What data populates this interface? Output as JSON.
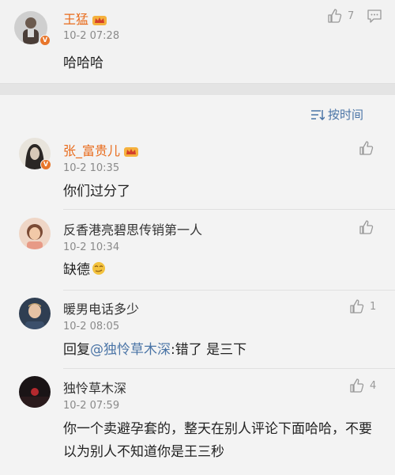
{
  "post": {
    "author": "王猛",
    "time": "10-2 07:28",
    "content": "哈哈哈",
    "like_count": "7"
  },
  "sort_label": "按时间",
  "comments": [
    {
      "author": "张_富贵儿",
      "time": "10-2 10:35",
      "content": "你们过分了",
      "like_count": ""
    },
    {
      "author": "反香港亮碧思传销第一人",
      "time": "10-2 10:34",
      "content": "缺德",
      "like_count": ""
    },
    {
      "author": "暖男电话多少",
      "time": "10-2 08:05",
      "reply_prefix": "回复",
      "mention": "@独怜草木深",
      "content": ":错了 是三下",
      "like_count": "1"
    },
    {
      "author": "独怜草木深",
      "time": "10-2 07:59",
      "content_line1": "你一个卖避孕套的，整天在别人评论下面哈哈，不要",
      "content_line2": "以为别人不知道你是王三秒",
      "like_count": "4"
    }
  ],
  "colors": {
    "accent_orange": "#e86a1a",
    "link_blue": "#4a74a6",
    "vip_badge": "#e8762b"
  }
}
